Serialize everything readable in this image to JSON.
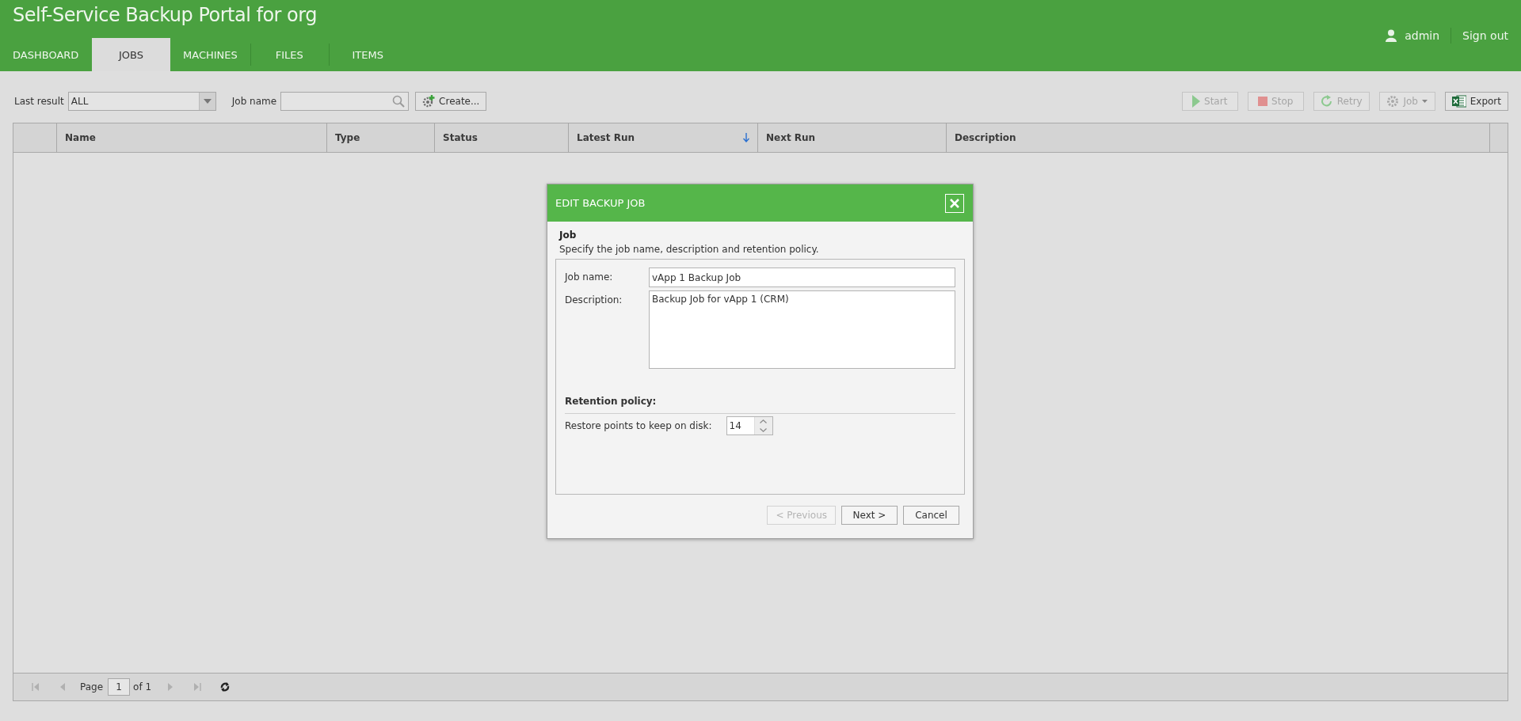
{
  "header": {
    "title": "Self-Service Backup Portal for org",
    "user": "admin",
    "sign_out": "Sign out"
  },
  "tabs": [
    {
      "label": "DASHBOARD",
      "selected": false
    },
    {
      "label": "JOBS",
      "selected": true
    },
    {
      "label": "MACHINES",
      "selected": false
    },
    {
      "label": "FILES",
      "selected": false
    },
    {
      "label": "ITEMS",
      "selected": false
    }
  ],
  "toolbar": {
    "filter_label": "Last result",
    "filter_value": "ALL",
    "search_label": "Job name",
    "create_button": "Create...",
    "actions": [
      {
        "label": "Start",
        "kind": "start",
        "disabled": true
      },
      {
        "label": "Stop",
        "kind": "stop",
        "disabled": true
      },
      {
        "label": "Retry",
        "kind": "retry",
        "disabled": true
      },
      {
        "label": "Job",
        "kind": "job",
        "disabled": true
      },
      {
        "label": "Export",
        "kind": "export",
        "disabled": false
      }
    ]
  },
  "table": {
    "columns": [
      {
        "label": "Name",
        "sorted": false
      },
      {
        "label": "Type",
        "sorted": false
      },
      {
        "label": "Status",
        "sorted": false
      },
      {
        "label": "Latest Run",
        "sorted": true
      },
      {
        "label": "Next Run",
        "sorted": false
      },
      {
        "label": "Description",
        "sorted": false
      }
    ]
  },
  "pager": {
    "page_label": "Page",
    "page_value": "1",
    "of_label": "of 1",
    "buttons": [
      {
        "kind": "first",
        "disabled": true
      },
      {
        "kind": "prev",
        "disabled": true
      },
      {
        "kind": "next",
        "disabled": true
      },
      {
        "kind": "last",
        "disabled": true
      },
      {
        "kind": "refresh",
        "disabled": false
      }
    ]
  },
  "dialog": {
    "title": "EDIT BACKUP JOB",
    "section_title": "Job",
    "section_hint": "Specify the job name, description and retention policy.",
    "fields": [
      {
        "label": "Job name:",
        "value": "vApp 1 Backup Job",
        "kind": "text"
      },
      {
        "label": "Description:",
        "value": "Backup Job for vApp 1 (CRM)",
        "kind": "textarea"
      }
    ],
    "retention_title": "Retention policy:",
    "restore_points": {
      "label": "Restore points to keep on disk:",
      "value": "14"
    },
    "buttons": [
      {
        "label": "< Previous",
        "disabled": true
      },
      {
        "label": "Next >",
        "disabled": false
      },
      {
        "label": "Cancel",
        "disabled": false
      }
    ]
  }
}
